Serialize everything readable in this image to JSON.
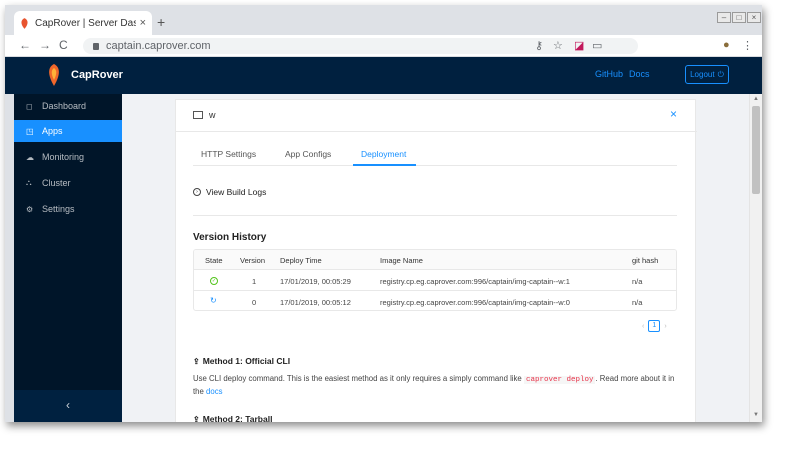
{
  "browser": {
    "tab_title": "CapRover | Server Dashb",
    "tab_close": "×",
    "new_tab": "+",
    "url": "captain.caprover.com",
    "back": "←",
    "forward": "→",
    "reload": "C",
    "win_min": "–",
    "win_max": "□",
    "win_close": "×",
    "icons": {
      "key": "key-icon",
      "star": "star-icon",
      "ext": "extension-icon",
      "cast": "cast-icon",
      "profile": "profile-icon",
      "menu": "menu-icon"
    }
  },
  "header": {
    "brand": "CapRover",
    "github": "GitHub",
    "docs": "Docs",
    "logout": "Logout",
    "brand_color": "#00203f",
    "accent": "#1890ff"
  },
  "sidebar": {
    "items": [
      {
        "label": "Dashboard",
        "icon": "◻"
      },
      {
        "label": "Apps",
        "icon": "◳"
      },
      {
        "label": "Monitoring",
        "icon": "☁"
      },
      {
        "label": "Cluster",
        "icon": "⛬"
      },
      {
        "label": "Settings",
        "icon": "⚙"
      }
    ],
    "collapse": "‹"
  },
  "app": {
    "name": "w",
    "close": "×",
    "tabs": [
      "HTTP Settings",
      "App Configs",
      "Deployment"
    ],
    "build_logs": "View Build Logs",
    "version_history": {
      "title": "Version History",
      "columns": [
        "State",
        "Version",
        "Deploy Time",
        "Image Name",
        "git hash"
      ],
      "rows": [
        {
          "version": "1",
          "time": "17/01/2019, 00:05:29",
          "image": "registry.cp.eg.caprover.com:996/captain/img-captain--w:1",
          "hash": "n/a"
        },
        {
          "version": "0",
          "time": "17/01/2019, 00:05:12",
          "image": "registry.cp.eg.caprover.com:996/captain/img-captain--w:0",
          "hash": "n/a"
        }
      ],
      "page": "1",
      "prev": "‹",
      "next": "›"
    },
    "method1": {
      "title": "Method 1: Official CLI",
      "text_before": "Use CLI deploy command. This is the easiest method as it only requires a simply command like ",
      "code": "caprover deploy",
      "text_after": ". Read more about it in the ",
      "link": "docs"
    },
    "method2": {
      "title": "Method 2: Tarball"
    }
  }
}
